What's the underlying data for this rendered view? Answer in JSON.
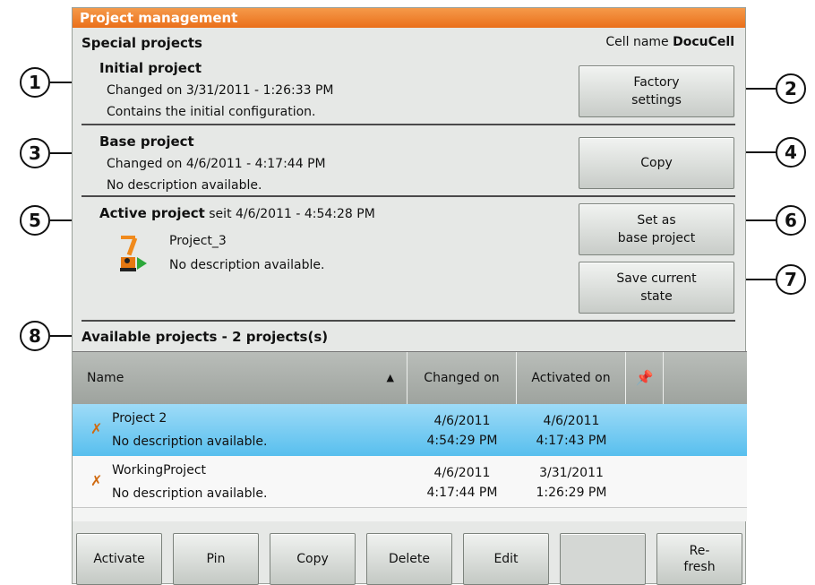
{
  "window": {
    "title": "Project management"
  },
  "special": {
    "heading": "Special projects",
    "cell_name_label": "Cell name",
    "cell_name_value": "DocuCell"
  },
  "initial": {
    "title": "Initial project",
    "changed": "Changed on 3/31/2011 - 1:26:33 PM",
    "desc": "Contains the initial configuration.",
    "button": "Factory\nsettings"
  },
  "base": {
    "title": "Base project",
    "changed": "Changed on 4/6/2011 - 4:17:44 PM",
    "desc": "No description available.",
    "button": "Copy"
  },
  "active": {
    "title": "Active project",
    "since": "seit 4/6/2011 - 4:54:28 PM",
    "name": "Project_3",
    "desc": "No description available.",
    "set_base_button": "Set as\nbase project",
    "save_button": "Save current\nstate"
  },
  "available": {
    "heading": "Available projects - 2 projects(s)",
    "columns": [
      "Name",
      "Changed on",
      "Activated on"
    ],
    "rows": [
      {
        "name": "Project 2",
        "desc": "No description available.",
        "changed_date": "4/6/2011",
        "changed_time": "4:54:29 PM",
        "activated_date": "4/6/2011",
        "activated_time": "4:17:43 PM"
      },
      {
        "name": "WorkingProject",
        "desc": "No description available.",
        "changed_date": "4/6/2011",
        "changed_time": "4:17:44 PM",
        "activated_date": "3/31/2011",
        "activated_time": "1:26:29 PM"
      }
    ]
  },
  "footer": {
    "activate": "Activate",
    "pin": "Pin",
    "copy": "Copy",
    "delete": "Delete",
    "edit": "Edit",
    "refresh": "Re-\nfresh"
  },
  "callouts": [
    "1",
    "2",
    "3",
    "4",
    "5",
    "6",
    "7",
    "8"
  ],
  "colors": {
    "title_bar": "#ea6f1a",
    "selected_row": "#58bfee"
  }
}
